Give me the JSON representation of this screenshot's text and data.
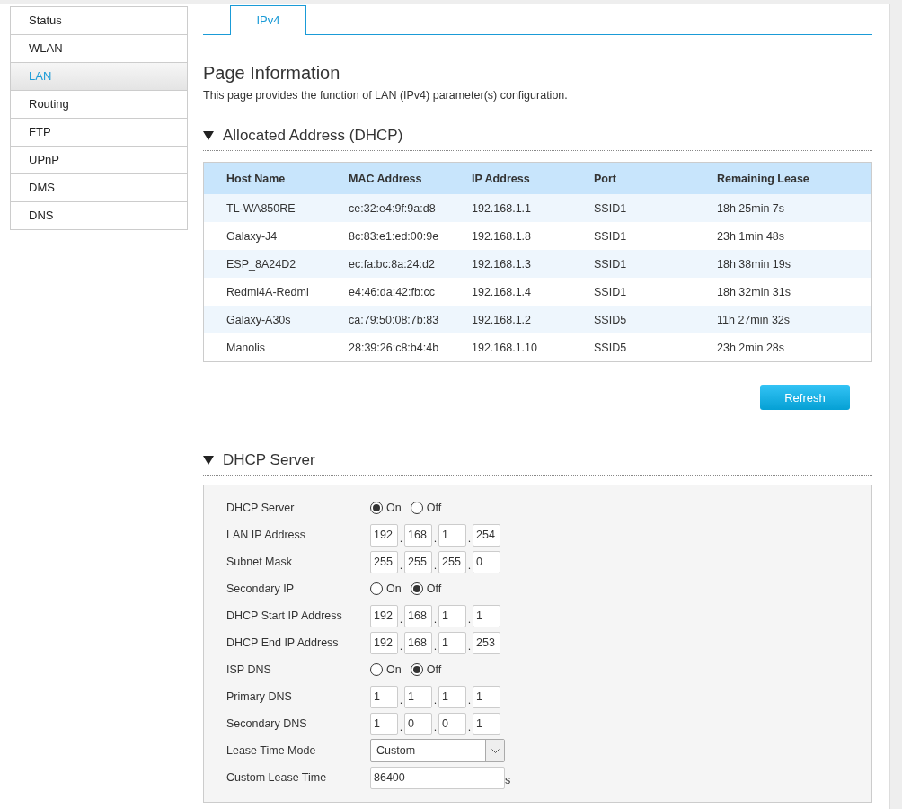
{
  "sidebar": {
    "items": [
      {
        "label": "Status",
        "selected": false
      },
      {
        "label": "WLAN",
        "selected": false
      },
      {
        "label": "LAN",
        "selected": true
      },
      {
        "label": "Routing",
        "selected": false
      },
      {
        "label": "FTP",
        "selected": false
      },
      {
        "label": "UPnP",
        "selected": false
      },
      {
        "label": "DMS",
        "selected": false
      },
      {
        "label": "DNS",
        "selected": false
      }
    ]
  },
  "tabs": [
    {
      "label": "IPv4",
      "selected": true
    }
  ],
  "page_info": {
    "title": "Page Information",
    "description": "This page provides the function of LAN (IPv4) parameter(s) configuration."
  },
  "allocated": {
    "heading": "Allocated Address (DHCP)",
    "expanded": true,
    "columns": [
      "Host Name",
      "MAC Address",
      "IP Address",
      "Port",
      "Remaining Lease"
    ],
    "rows": [
      [
        "TL-WA850RE",
        "ce:32:e4:9f:9a:d8",
        "192.168.1.1",
        "SSID1",
        "18h 25min 7s"
      ],
      [
        "Galaxy-J4",
        "8c:83:e1:ed:00:9e",
        "192.168.1.8",
        "SSID1",
        "23h 1min 48s"
      ],
      [
        "ESP_8A24D2",
        "ec:fa:bc:8a:24:d2",
        "192.168.1.3",
        "SSID1",
        "18h 38min 19s"
      ],
      [
        "Redmi4A-Redmi",
        "e4:46:da:42:fb:cc",
        "192.168.1.4",
        "SSID1",
        "18h 32min 31s"
      ],
      [
        "Galaxy-A30s",
        "ca:79:50:08:7b:83",
        "192.168.1.2",
        "SSID5",
        "11h 27min 32s"
      ],
      [
        "Manolis",
        "28:39:26:c8:b4:4b",
        "192.168.1.10",
        "SSID5",
        "23h 2min 28s"
      ]
    ],
    "button": "Refresh"
  },
  "dhcp_server": {
    "heading": "DHCP Server",
    "expanded": true,
    "fields": [
      {
        "kind": "radio",
        "label": "DHCP Server",
        "options": [
          {
            "label": "On",
            "selected": true
          },
          {
            "label": "Off",
            "selected": false
          }
        ]
      },
      {
        "kind": "ip",
        "label": "LAN IP Address",
        "octets": [
          "192",
          "168",
          "1",
          "254"
        ],
        "separators": [
          ".",
          ".",
          "."
        ]
      },
      {
        "kind": "ip",
        "label": "Subnet Mask",
        "octets": [
          "255",
          "255",
          "255",
          "0"
        ],
        "separators": [
          ".",
          ".",
          "."
        ]
      },
      {
        "kind": "radio",
        "label": "Secondary IP",
        "options": [
          {
            "label": "On",
            "selected": false
          },
          {
            "label": "Off",
            "selected": true
          }
        ]
      },
      {
        "kind": "ip",
        "label": "DHCP Start IP Address",
        "octets": [
          "192",
          "168",
          "1",
          "1"
        ],
        "separators": [
          ".",
          ".",
          "."
        ]
      },
      {
        "kind": "ip",
        "label": "DHCP End IP Address",
        "octets": [
          "192",
          "168",
          "1",
          "253"
        ],
        "separators": [
          ".",
          ".",
          "."
        ]
      },
      {
        "kind": "radio",
        "label": "ISP DNS",
        "options": [
          {
            "label": "On",
            "selected": false
          },
          {
            "label": "Off",
            "selected": true
          }
        ]
      },
      {
        "kind": "ip",
        "label": "Primary DNS",
        "octets": [
          "1",
          "1",
          "1",
          "1"
        ],
        "separators": [
          ".",
          ".",
          "."
        ]
      },
      {
        "kind": "ip",
        "label": "Secondary DNS",
        "octets": [
          "1",
          "0",
          "0",
          "1"
        ],
        "separators": [
          ".",
          ".",
          "."
        ]
      },
      {
        "kind": "select",
        "label": "Lease Time Mode",
        "value": "Custom"
      },
      {
        "kind": "text",
        "label": "Custom Lease Time",
        "value": "86400",
        "unit": "s"
      }
    ]
  }
}
